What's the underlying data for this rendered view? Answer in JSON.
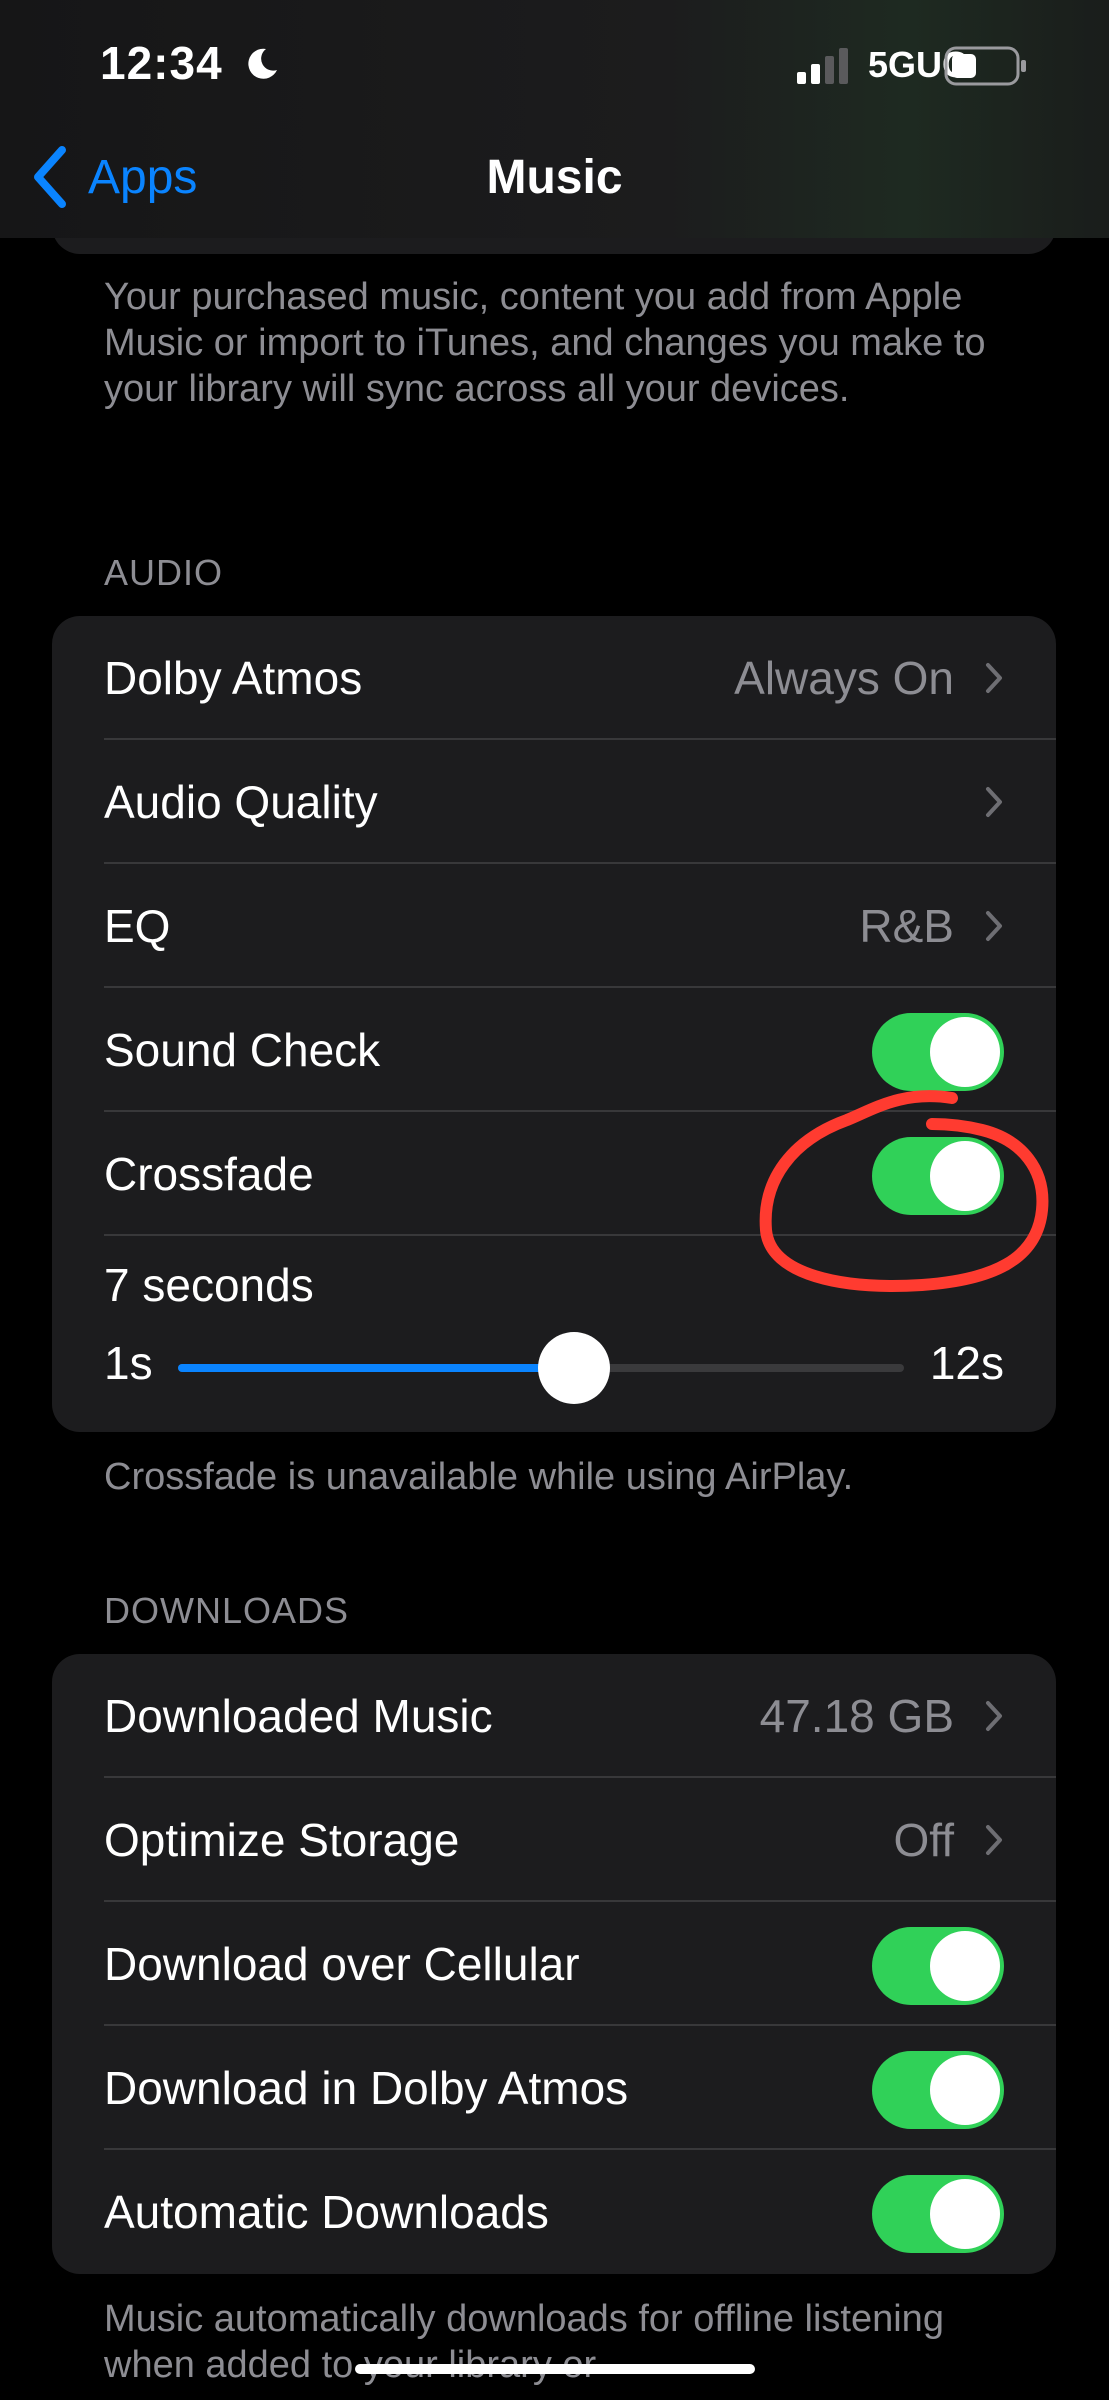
{
  "status_bar": {
    "time": "12:34",
    "network": "5GUC",
    "focus_icon": "moon-icon",
    "battery_icon": "battery-icon"
  },
  "nav": {
    "back_label": "Apps",
    "title": "Music"
  },
  "sync_footnote": "Your purchased music, content you add from Apple Music or import to iTunes, and changes you make to your library will sync across all your devices.",
  "audio": {
    "header": "AUDIO",
    "rows": [
      {
        "label": "Dolby Atmos",
        "value": "Always On"
      },
      {
        "label": "Audio Quality",
        "value": ""
      },
      {
        "label": "EQ",
        "value": "R&B"
      },
      {
        "label": "Sound Check",
        "on": true
      },
      {
        "label": "Crossfade",
        "on": true
      }
    ],
    "crossfade_slider": {
      "value_text": "7 seconds",
      "min_label": "1s",
      "max_label": "12s",
      "min": 1,
      "max": 12,
      "value": 7
    },
    "footnote": "Crossfade is unavailable while using AirPlay."
  },
  "downloads": {
    "header": "DOWNLOADS",
    "rows": [
      {
        "label": "Downloaded Music",
        "value": "47.18 GB"
      },
      {
        "label": "Optimize Storage",
        "value": "Off"
      },
      {
        "label": "Download over Cellular",
        "on": true
      },
      {
        "label": "Download in Dolby Atmos",
        "on": true
      },
      {
        "label": "Automatic Downloads",
        "on": true
      }
    ],
    "footnote": "Music automatically downloads for offline listening when added to your library or"
  },
  "colors": {
    "accent": "#0a84ff",
    "toggle_on": "#30d158",
    "annotation": "#ff3b30"
  }
}
